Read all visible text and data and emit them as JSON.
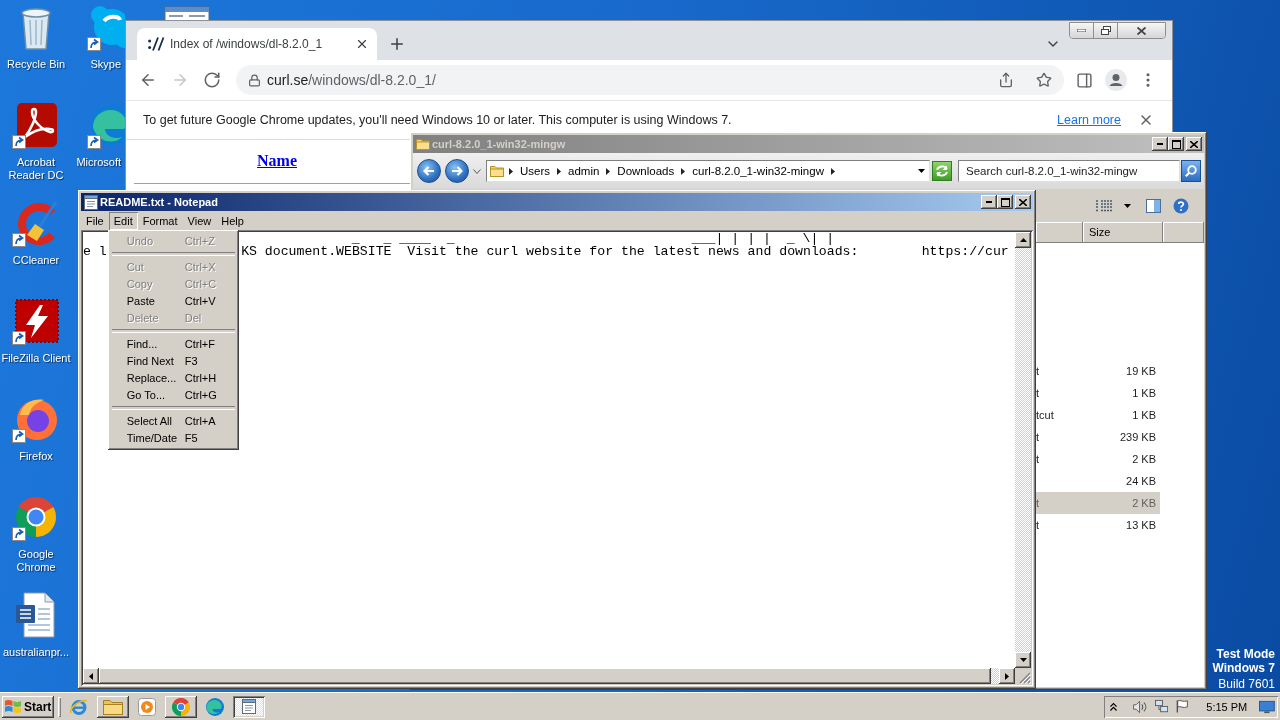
{
  "desktop": {
    "icon_columns": [
      {
        "icons": [
          {
            "label": "Recycle Bin",
            "kind": "recycle_bin",
            "shortcut": false
          },
          {
            "label": "Acrobat Reader DC",
            "kind": "acrobat",
            "shortcut": true
          },
          {
            "label": "CCleaner",
            "kind": "ccleaner",
            "shortcut": true
          },
          {
            "label": "FileZilla Client",
            "kind": "filezilla",
            "shortcut": true
          },
          {
            "label": "Firefox",
            "kind": "firefox",
            "shortcut": true
          },
          {
            "label": "Google Chrome",
            "kind": "chrome",
            "shortcut": true
          },
          {
            "label": "australianpr...",
            "kind": "word_doc",
            "shortcut": false
          }
        ]
      },
      {
        "icons": [
          {
            "label": "Skype",
            "kind": "skype",
            "shortcut": true
          },
          {
            "label": "Microsoft",
            "kind": "edge",
            "shortcut": true
          }
        ]
      },
      {
        "icons": [
          {
            "kind": "window",
            "shortcut": false
          }
        ]
      }
    ],
    "system_notice": [
      "Test Mode",
      "Windows 7",
      "Build 7601"
    ]
  },
  "browser": {
    "tabs": [
      {
        "title": "Index of /windows/dl-8.2.0_1",
        "selected": true
      }
    ],
    "nav": [
      {
        "kind": "back",
        "disabled": false
      },
      {
        "kind": "forward",
        "disabled": true
      },
      {
        "kind": "reload",
        "disabled": false
      }
    ],
    "address": {
      "host": "curl.se",
      "path": "/windows/dl-8.2.0_1/"
    },
    "infobar": {
      "message": "To get future Google Chrome updates, you'll need Windows 10 or later. This computer is using Windows 7.",
      "link": "Learn more"
    },
    "page": {
      "column_header": "Name"
    }
  },
  "explorer": {
    "title": "curl-8.2.0_1-win32-mingw",
    "active": false,
    "breadcrumb": [
      "Users",
      "admin",
      "Downloads",
      "curl-8.2.0_1-win32-mingw"
    ],
    "search": {
      "placeholder": "Search curl-8.2.0_1-win32-mingw"
    },
    "size_header": "Size",
    "files": [
      {
        "column_1": "t",
        "size": "19 KB",
        "selected": false
      },
      {
        "column_1": "t",
        "size": "1 KB",
        "selected": false
      },
      {
        "column_1": "tcut",
        "size": "1 KB",
        "selected": false
      },
      {
        "column_1": "t",
        "size": "239 KB",
        "selected": false
      },
      {
        "column_1": "t",
        "size": "2 KB",
        "selected": false
      },
      {
        "size": "24 KB",
        "selected": false
      },
      {
        "column_1": "t",
        "size": "2 KB",
        "selected": true
      },
      {
        "column_1": "t",
        "size": "13 KB",
        "selected": false
      }
    ]
  },
  "notepad": {
    "title": "README.txt - Notepad",
    "active": true,
    "menu": [
      {
        "label": "File",
        "selected": false
      },
      {
        "label": "Edit",
        "selected": true
      },
      {
        "label": "Format",
        "selected": false
      },
      {
        "label": "View",
        "selected": false
      },
      {
        "label": "Help",
        "selected": false
      }
    ],
    "lines": [
      {
        "segments": [
          "_   _ ____  _",
          "___| | | |  _ \\| |"
        ]
      },
      {
        "segments": [
          "e l",
          "KS document.WEBSITE  Visit the curl website for the latest news and downloads:        https://cur"
        ]
      }
    ],
    "edit_menu": {
      "sections": [
        {
          "items": [
            {
              "label": "Undo",
              "shortcut": "Ctrl+Z",
              "disabled": true
            }
          ]
        },
        {
          "items": [
            {
              "label": "Cut",
              "shortcut": "Ctrl+X",
              "disabled": true
            },
            {
              "label": "Copy",
              "shortcut": "Ctrl+C",
              "disabled": true
            },
            {
              "label": "Paste",
              "shortcut": "Ctrl+V",
              "disabled": false
            },
            {
              "label": "Delete",
              "shortcut": "Del",
              "disabled": true
            }
          ]
        },
        {
          "items": [
            {
              "label": "Find...",
              "shortcut": "Ctrl+F",
              "disabled": false
            },
            {
              "label": "Find Next",
              "shortcut": "F3",
              "disabled": false
            },
            {
              "label": "Replace...",
              "shortcut": "Ctrl+H",
              "disabled": false
            },
            {
              "label": "Go To...",
              "shortcut": "Ctrl+G",
              "disabled": false
            }
          ]
        },
        {
          "items": [
            {
              "label": "Select All",
              "shortcut": "Ctrl+A",
              "disabled": false
            },
            {
              "label": "Time/Date",
              "shortcut": "F5",
              "disabled": false
            }
          ]
        }
      ]
    }
  },
  "taskbar": {
    "start": "Start",
    "items": [
      {
        "kind": "ie",
        "open": false,
        "selected": false
      },
      {
        "kind": "folder",
        "open": true,
        "selected": false
      },
      {
        "kind": "media",
        "open": false,
        "selected": false
      },
      {
        "kind": "chrome",
        "open": true,
        "selected": false
      },
      {
        "kind": "edge",
        "open": false,
        "selected": false
      },
      {
        "kind": "notepad",
        "open": true,
        "selected": true
      }
    ],
    "clock": "5:15 PM"
  }
}
